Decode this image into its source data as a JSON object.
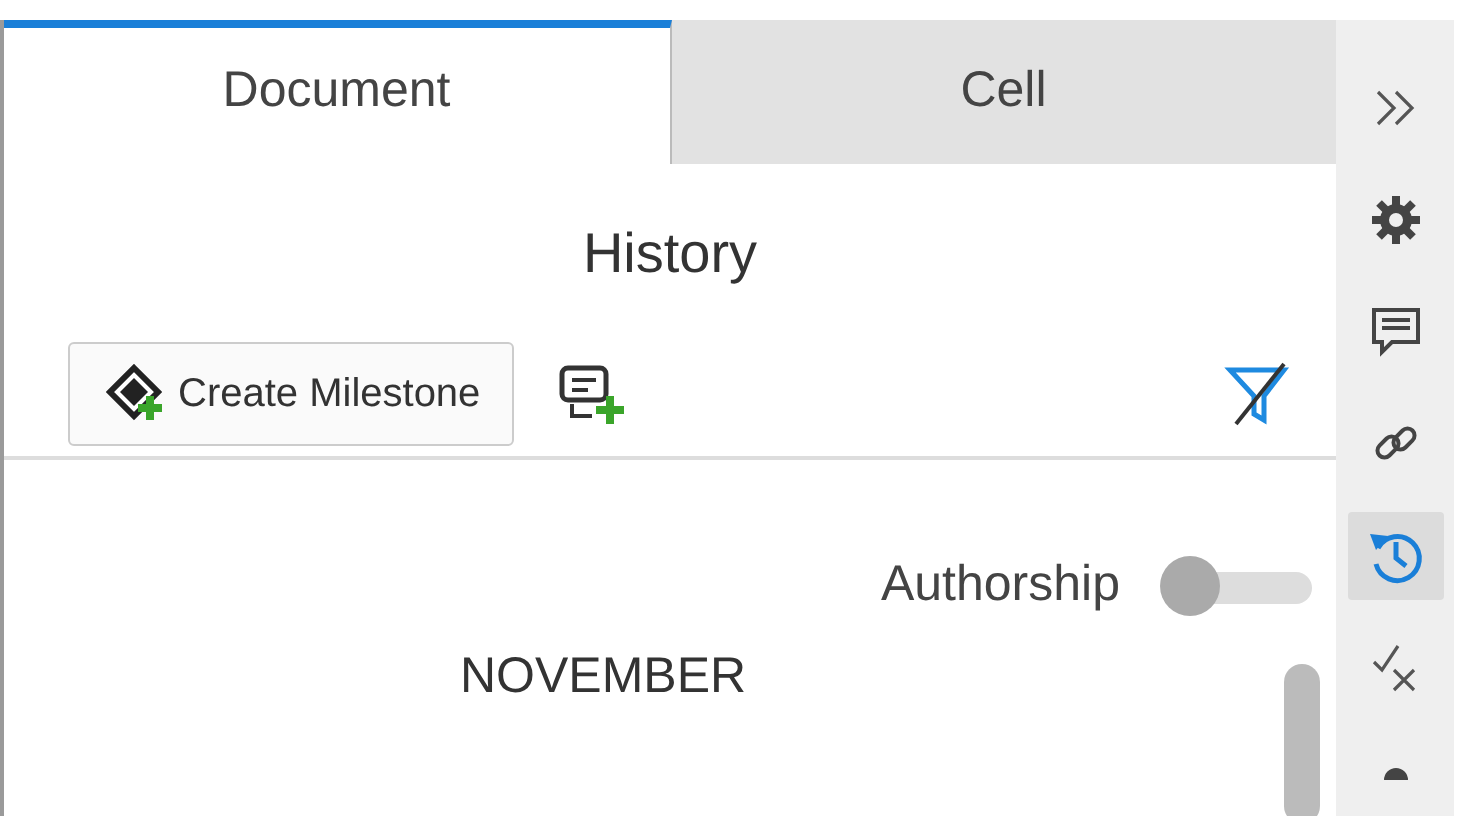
{
  "tabs": [
    {
      "label": "Document",
      "selected": true
    },
    {
      "label": "Cell",
      "selected": false
    }
  ],
  "panel": {
    "title": "History",
    "toolbar": {
      "create_button": {
        "label": "Create Milestone"
      }
    },
    "authorship": {
      "label": "Authorship",
      "on": false
    },
    "month_heading": "NOVEMBER"
  },
  "rail": [
    {
      "kind": "collapse",
      "selected": false
    },
    {
      "kind": "settings",
      "selected": false
    },
    {
      "kind": "comments",
      "selected": false
    },
    {
      "kind": "links",
      "selected": false
    },
    {
      "kind": "history",
      "selected": true
    },
    {
      "kind": "review",
      "selected": false
    },
    {
      "kind": "partial",
      "selected": false
    }
  ]
}
